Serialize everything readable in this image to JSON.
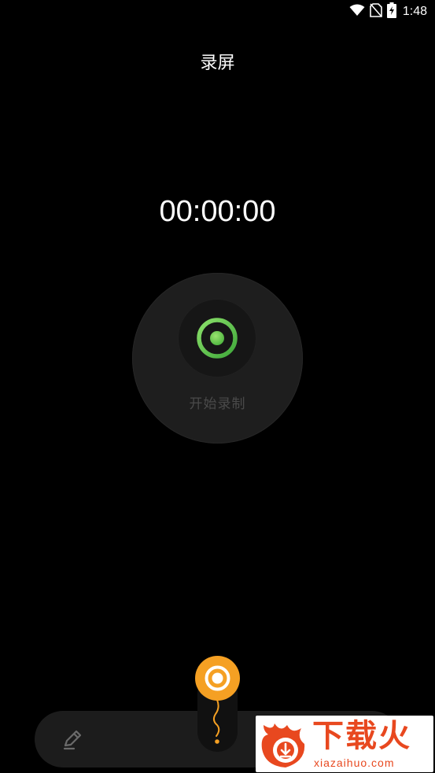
{
  "status_bar": {
    "time": "1:48",
    "icons": [
      "wifi-icon",
      "no-sim-icon",
      "battery-charging-icon"
    ]
  },
  "header": {
    "title": "录屏"
  },
  "timer": {
    "value": "00:00:00"
  },
  "record_button": {
    "label": "开始录制",
    "icon": "record-icon",
    "accent_color": "#6ccb4c"
  },
  "bottom_bar": {
    "icons": [
      "pen-icon"
    ]
  },
  "floating_button": {
    "icon": "record-icon",
    "color": "#f5a023"
  },
  "watermark": {
    "text": "下载火",
    "url": "xiazaihuo.com",
    "color": "#e8481f"
  }
}
